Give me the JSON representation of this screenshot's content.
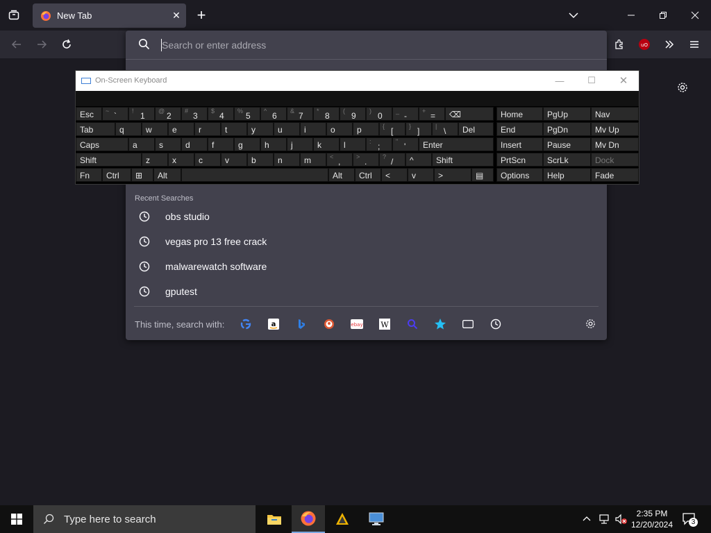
{
  "browser": {
    "tab_title": "New Tab",
    "urlbar_placeholder": "Search or enter address"
  },
  "urlbar_popup": {
    "recent_heading": "Recent Searches",
    "recent": [
      "obs studio",
      "vegas pro 13 free crack",
      "malwarewatch software",
      "gputest"
    ],
    "oneoff_label": "This time, search with:",
    "engines": [
      "google-icon",
      "amazon-icon",
      "bing-icon",
      "duckduckgo-icon",
      "ebay-icon",
      "wikipedia-icon",
      "search-engine-icon",
      "bookmarks-star-icon",
      "tabs-icon",
      "history-icon"
    ]
  },
  "osk": {
    "title": "On-Screen Keyboard",
    "rows": {
      "r1": [
        {
          "main": "Esc"
        },
        {
          "sym": "~",
          "low": "`"
        },
        {
          "sym": "!",
          "low": "1"
        },
        {
          "sym": "@",
          "low": "2"
        },
        {
          "sym": "#",
          "low": "3"
        },
        {
          "sym": "$",
          "low": "4"
        },
        {
          "sym": "%",
          "low": "5"
        },
        {
          "sym": "^",
          "low": "6"
        },
        {
          "sym": "&",
          "low": "7"
        },
        {
          "sym": "*",
          "low": "8"
        },
        {
          "sym": "(",
          "low": "9"
        },
        {
          "sym": ")",
          "low": "0"
        },
        {
          "sym": "_",
          "low": "-"
        },
        {
          "sym": "+",
          "low": "="
        },
        {
          "main": "⌫"
        }
      ],
      "r2": [
        "Tab",
        "q",
        "w",
        "e",
        "r",
        "t",
        "y",
        "u",
        "i",
        "o",
        "p",
        "[",
        "]",
        "\\",
        "Del"
      ],
      "r2_syms": {
        "[": "{",
        "]": "}",
        "\\": "|"
      },
      "r3": [
        "Caps",
        "a",
        "s",
        "d",
        "f",
        "g",
        "h",
        "j",
        "k",
        "l",
        ";",
        "'",
        "Enter"
      ],
      "r3_syms": {
        ";": ":",
        "'": "\""
      },
      "r4": [
        "Shift",
        "z",
        "x",
        "c",
        "v",
        "b",
        "n",
        "m",
        ",",
        ".",
        "/",
        "^",
        "Shift"
      ],
      "r4_syms": {
        ",": "<",
        ".": ">",
        "/": "?"
      },
      "r5": [
        "Fn",
        "Ctrl",
        "⊞",
        "Alt",
        "",
        "Alt",
        "Ctrl",
        "<",
        "v",
        ">",
        "▤"
      ]
    },
    "nav_keys": [
      [
        "Home",
        "PgUp",
        "Nav"
      ],
      [
        "End",
        "PgDn",
        "Mv Up"
      ],
      [
        "Insert",
        "Pause",
        "Mv Dn"
      ],
      [
        "PrtScn",
        "ScrLk",
        "Dock"
      ],
      [
        "Options",
        "Help",
        "Fade"
      ]
    ]
  },
  "taskbar": {
    "search_placeholder": "Type here to search",
    "time": "2:35 PM",
    "date": "12/20/2024",
    "notifications": "3"
  }
}
